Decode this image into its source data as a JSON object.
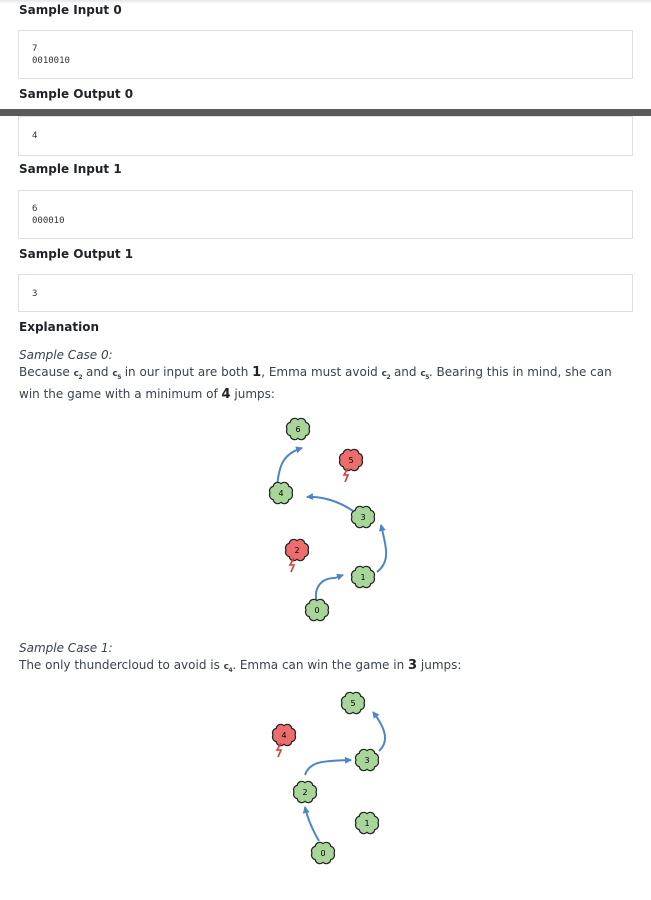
{
  "sample_input_0": {
    "heading": "Sample Input 0",
    "lines": [
      "7",
      "0010010"
    ]
  },
  "sample_output_0": {
    "heading": "Sample Output 0",
    "lines": [
      "4"
    ]
  },
  "sample_input_1": {
    "heading": "Sample Input 1",
    "lines": [
      "6",
      "000010"
    ]
  },
  "sample_output_1": {
    "heading": "Sample Output 1",
    "lines": [
      "3"
    ]
  },
  "explanation": {
    "heading": "Explanation",
    "case0": {
      "title": "Sample Case 0:",
      "t1": "Because ",
      "c1_base": "c",
      "c1_sub": "2",
      "t2": " and ",
      "c2_base": "c",
      "c2_sub": "5",
      "t3": " in our input are both ",
      "n1": "1",
      "t4": ", Emma must avoid ",
      "c3_base": "c",
      "c3_sub": "2",
      "t5": " and ",
      "c4_base": "c",
      "c4_sub": "5",
      "t6": ". Bearing this in mind, she can win the game with a minimum of ",
      "n2": "4",
      "t7": " jumps:"
    },
    "case1": {
      "title": "Sample Case 1:",
      "t1": "The only thundercloud to avoid is ",
      "c1_base": "c",
      "c1_sub": "4",
      "t2": ". Emma can win the game in ",
      "n1": "3",
      "t3": " jumps:"
    }
  },
  "figure0": {
    "clouds": [
      {
        "label": "0",
        "type": "cumulus"
      },
      {
        "label": "1",
        "type": "cumulus"
      },
      {
        "label": "2",
        "type": "thunder"
      },
      {
        "label": "3",
        "type": "cumulus"
      },
      {
        "label": "4",
        "type": "cumulus"
      },
      {
        "label": "5",
        "type": "thunder"
      },
      {
        "label": "6",
        "type": "cumulus"
      }
    ]
  },
  "figure1": {
    "clouds": [
      {
        "label": "0",
        "type": "cumulus"
      },
      {
        "label": "1",
        "type": "cumulus"
      },
      {
        "label": "2",
        "type": "cumulus"
      },
      {
        "label": "3",
        "type": "cumulus"
      },
      {
        "label": "4",
        "type": "thunder"
      },
      {
        "label": "5",
        "type": "cumulus"
      }
    ]
  },
  "colors": {
    "cumulus": "#a8d59a",
    "thunder": "#ec6d6d",
    "arrow": "#4a86c8",
    "outline": "#222222"
  }
}
